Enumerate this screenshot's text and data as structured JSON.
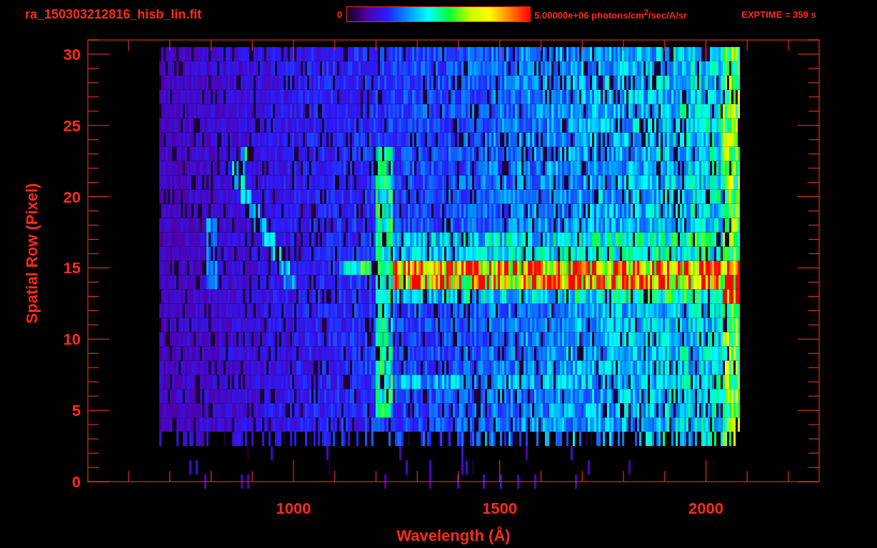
{
  "title": "ra_150303212816_hisb_lin.fit",
  "colorbar": {
    "min_label": "0",
    "max_label": "5.00000e+06 photons/cm$^{2}$/sec/A/sr"
  },
  "exposure": "EXPTIME = 359 s",
  "plot": {
    "xlabel": "Wavelength (Å)",
    "ylabel": "Spatial Row (Pixel)",
    "xticks": [
      "1000",
      "1500",
      "2000"
    ],
    "yticks": [
      "30",
      "25",
      "20",
      "15",
      "10",
      "5",
      "0"
    ]
  }
}
